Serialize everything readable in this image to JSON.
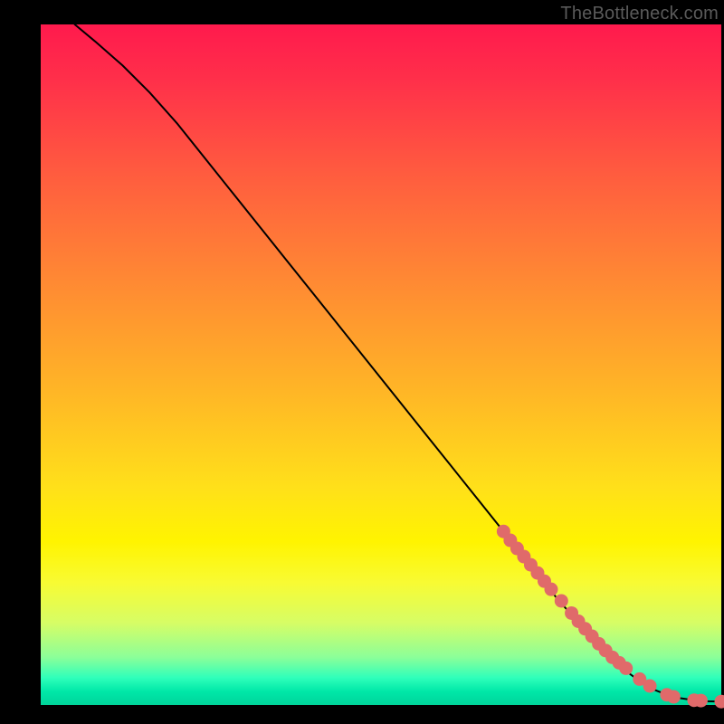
{
  "attribution": "TheBottleneck.com",
  "colors": {
    "background": "#000000",
    "curve": "#000000",
    "marker_fill": "#e06a6a",
    "marker_stroke": "#c74f4f"
  },
  "chart_data": {
    "type": "line",
    "title": "",
    "xlabel": "",
    "ylabel": "",
    "xlim": [
      0,
      100
    ],
    "ylim": [
      0,
      100
    ],
    "grid": false,
    "legend": false,
    "note": "No axis ticks or labels are rendered in the image; x/y values are normalized 0–100 by position.",
    "series": [
      {
        "name": "curve",
        "type": "line",
        "x": [
          5,
          8,
          12,
          16,
          20,
          24,
          28,
          32,
          36,
          40,
          44,
          48,
          52,
          56,
          60,
          64,
          68,
          72,
          76,
          80,
          84,
          86,
          88,
          90,
          92,
          94,
          96,
          98,
          100
        ],
        "y": [
          100,
          97.5,
          94,
          90,
          85.5,
          80.5,
          75.5,
          70.5,
          65.5,
          60.5,
          55.5,
          50.5,
          45.5,
          40.5,
          35.5,
          30.5,
          25.5,
          20.5,
          15.5,
          11,
          7,
          5,
          3.5,
          2.3,
          1.5,
          1,
          0.7,
          0.55,
          0.5
        ]
      },
      {
        "name": "markers",
        "type": "scatter",
        "x": [
          68,
          69,
          70,
          71,
          72,
          73,
          74,
          75,
          76.5,
          78,
          79,
          80,
          81,
          82,
          83,
          84,
          85,
          86,
          88,
          89.5,
          92,
          93,
          96,
          97,
          100
        ],
        "y": [
          25.5,
          24.2,
          23,
          21.8,
          20.6,
          19.4,
          18.2,
          17,
          15.3,
          13.5,
          12.3,
          11.2,
          10.1,
          9,
          8,
          7,
          6.2,
          5.4,
          3.8,
          2.8,
          1.5,
          1.2,
          0.7,
          0.65,
          0.5
        ]
      }
    ]
  }
}
